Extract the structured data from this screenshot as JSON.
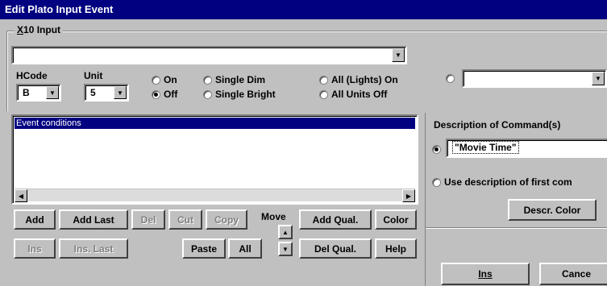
{
  "window": {
    "title": "Edit Plato Input Event"
  },
  "x10_input": {
    "group_label_prefix": "X",
    "group_label_rest": "10 Input",
    "device_combo_value": "",
    "hcode_label": "HCode",
    "hcode_value": "B",
    "unit_label": "Unit",
    "unit_value": "5",
    "radios": {
      "on": "On",
      "off": "Off",
      "single_dim": "Single Dim",
      "single_bright": "Single Bright",
      "all_lights_on": "All (Lights) On",
      "all_units_off": "All Units Off"
    },
    "extra_combo_value": ""
  },
  "event_conditions": {
    "header": "Event conditions",
    "items": []
  },
  "buttons": {
    "add": "Add",
    "add_last": "Add Last",
    "del": "Del",
    "cut": "Cut",
    "copy": "Copy",
    "move_label": "Move",
    "add_qual": "Add Qual.",
    "color": "Color",
    "ins": "Ins",
    "ins_last": "Ins. Last",
    "paste": "Paste",
    "all": "All",
    "del_qual": "Del Qual.",
    "help": "Help"
  },
  "description": {
    "label": "Description of Command(s)",
    "custom_value": "\"Movie Time\"",
    "use_first_label": "Use description of first com",
    "descr_color": "Descr. Color"
  },
  "dialog_buttons": {
    "ins_label": "Ins",
    "cancel_label": "Cance"
  },
  "icons": {
    "combo_arrow": "▼",
    "scroll_left": "◀",
    "scroll_right": "▶",
    "move_up": "▲",
    "move_down": "▼"
  }
}
